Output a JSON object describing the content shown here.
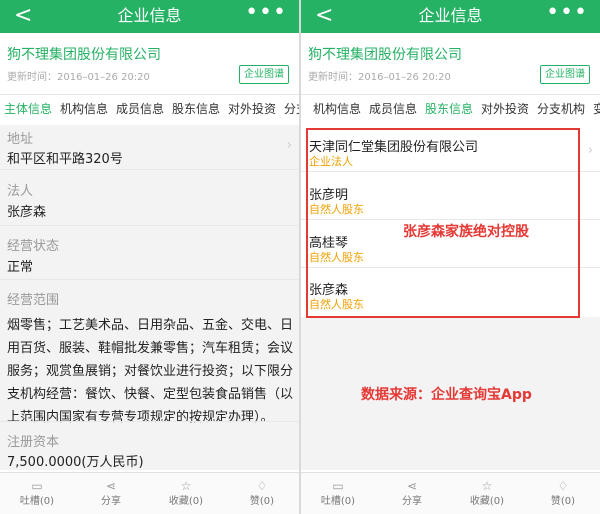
{
  "left": {
    "nav": {
      "back": "<",
      "title": "企业信息",
      "more": "•••"
    },
    "company_name": "狗不理集团股份有限公司",
    "updated": "更新时间：2016–01–26 20:20",
    "map_button": "企业图谱",
    "tabs": [
      "主体信息",
      "机构信息",
      "成员信息",
      "股东信息",
      "对外投资",
      "分支"
    ],
    "active_tab": "主体信息",
    "fields": {
      "address_label": "地址",
      "address": "和平区和平路320号",
      "legal_label": "法人",
      "legal": "张彦森",
      "status_label": "经营状态",
      "status": "正常",
      "scope_label": "经营范围",
      "scope": "烟零售；工艺美术品、日用杂品、五金、交电、日用百货、服装、鞋帽批发兼零售；汽车租赁；会议服务；观赏鱼展销；对餐饮业进行投资；以下限分支机构经营：餐饮、快餐、定型包装食品销售（以上范围内国家有专营专项规定的按规定办理）。",
      "capital_label": "注册资本",
      "capital": "7,500.0000(万人民币)"
    },
    "bottom": [
      "吐槽(0)",
      "分享",
      "收藏(0)",
      "赞(0)"
    ]
  },
  "right": {
    "nav": {
      "back": "<",
      "title": "企业信息",
      "more": "•••"
    },
    "company_name": "狗不理集团股份有限公司",
    "updated": "更新时间：2016–01–26 20:20",
    "map_button": "企业图谱",
    "tabs": [
      "机构信息",
      "成员信息",
      "股东信息",
      "对外投资",
      "分支机构",
      "变"
    ],
    "active_tab": "股东信息",
    "shareholders": [
      {
        "name": "天津同仁堂集团股份有限公司",
        "type": "企业法人"
      },
      {
        "name": "张彦明",
        "type": "自然人股东"
      },
      {
        "name": "高桂琴",
        "type": "自然人股东"
      },
      {
        "name": "张彦森",
        "type": "自然人股东"
      }
    ],
    "note_family": "张彦森家族绝对控股",
    "note_source": "数据来源：企业查询宝App",
    "bottom": [
      "吐槽(0)",
      "分享",
      "收藏(0)",
      "赞(0)"
    ]
  },
  "colors": {
    "brand_green": "#25b264",
    "shareholder_type": "#f0a000",
    "annotation_red": "#e53935"
  }
}
